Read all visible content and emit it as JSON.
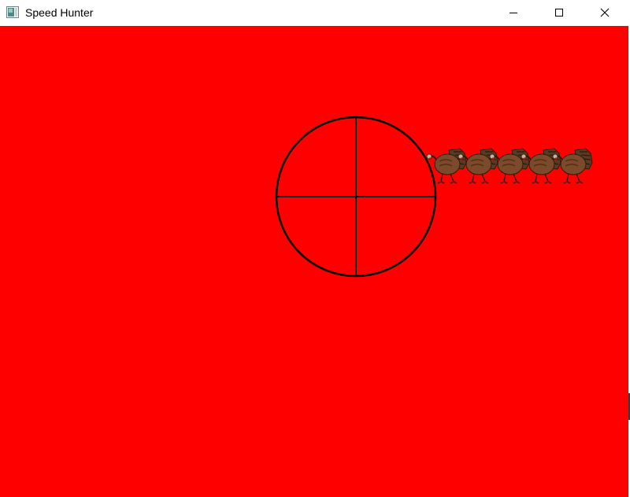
{
  "window": {
    "title": "Speed Hunter",
    "app_icon": "window-app-icon",
    "controls": {
      "minimize_icon": "minimize-icon",
      "maximize_icon": "maximize-icon",
      "close_icon": "close-icon"
    }
  },
  "game": {
    "background_color": "#ff0000",
    "crosshair": {
      "icon": "crosshair-reticle",
      "color": "#000000"
    },
    "turkeys": {
      "icon": "turkey-sprite",
      "count": 5
    }
  }
}
